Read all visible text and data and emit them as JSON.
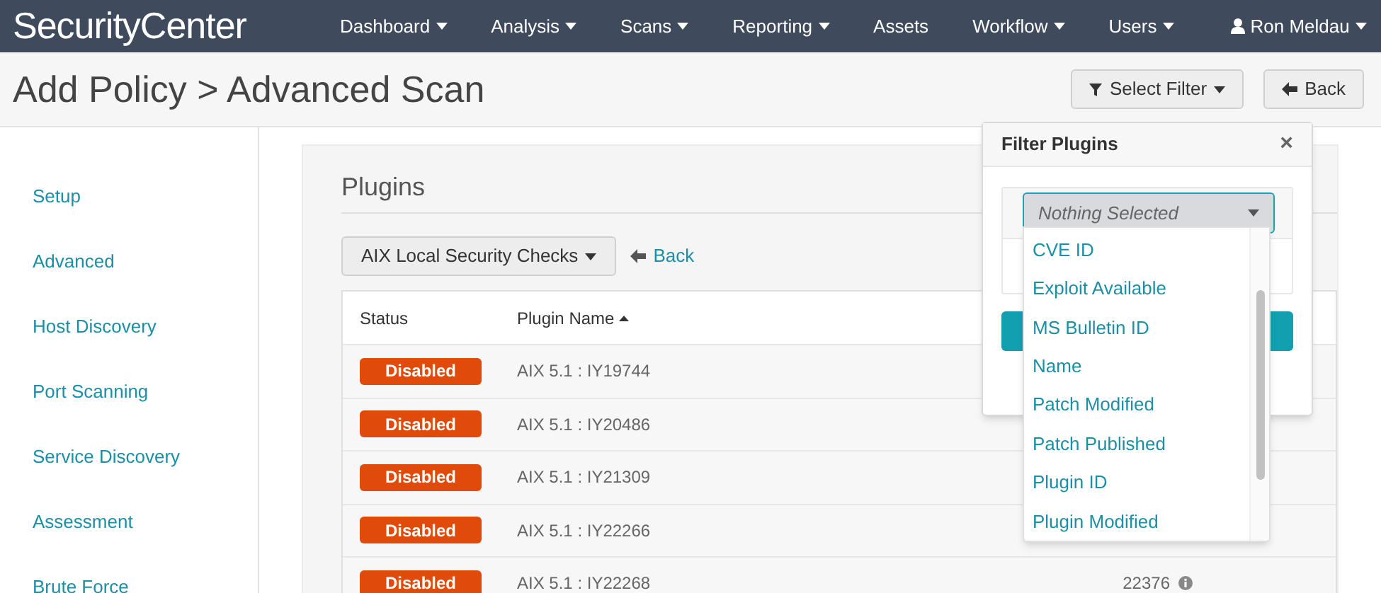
{
  "navbar": {
    "logo": "SecurityCenter",
    "menu": [
      {
        "label": "Dashboard",
        "caret": true
      },
      {
        "label": "Analysis",
        "caret": true
      },
      {
        "label": "Scans",
        "caret": true
      },
      {
        "label": "Reporting",
        "caret": true
      },
      {
        "label": "Assets",
        "caret": false
      },
      {
        "label": "Workflow",
        "caret": true
      },
      {
        "label": "Users",
        "caret": true
      }
    ],
    "user": "Ron Meldau"
  },
  "header": {
    "title": "Add Policy > Advanced Scan",
    "select_filter": "Select Filter",
    "back": "Back"
  },
  "sidebar": {
    "items": [
      {
        "label": "Setup"
      },
      {
        "label": "Advanced"
      },
      {
        "label": "Host Discovery"
      },
      {
        "label": "Port Scanning"
      },
      {
        "label": "Service Discovery"
      },
      {
        "label": "Assessment"
      },
      {
        "label": "Brute Force"
      }
    ]
  },
  "plugins": {
    "title": "Plugins",
    "family": "AIX Local Security Checks",
    "back": "Back",
    "columns": [
      "Status",
      "Plugin Name"
    ],
    "rows": [
      {
        "status": "Disabled",
        "name": "AIX 5.1 : IY19744"
      },
      {
        "status": "Disabled",
        "name": "AIX 5.1 : IY20486"
      },
      {
        "status": "Disabled",
        "name": "AIX 5.1 : IY21309"
      },
      {
        "status": "Disabled",
        "name": "AIX 5.1 : IY22266"
      },
      {
        "status": "Disabled",
        "name": "AIX 5.1 : IY22268",
        "plugin_id": "22376"
      }
    ]
  },
  "filter_popover": {
    "title": "Filter Plugins",
    "close": "×",
    "select": {
      "placeholder": "Nothing Selected",
      "options": [
        {
          "label": "CVE ID"
        },
        {
          "label": "Exploit Available"
        },
        {
          "label": "MS Bulletin ID"
        },
        {
          "label": "Name"
        },
        {
          "label": "Patch Modified"
        },
        {
          "label": "Patch Published"
        },
        {
          "label": "Plugin ID"
        },
        {
          "label": "Plugin Modified"
        }
      ]
    }
  }
}
